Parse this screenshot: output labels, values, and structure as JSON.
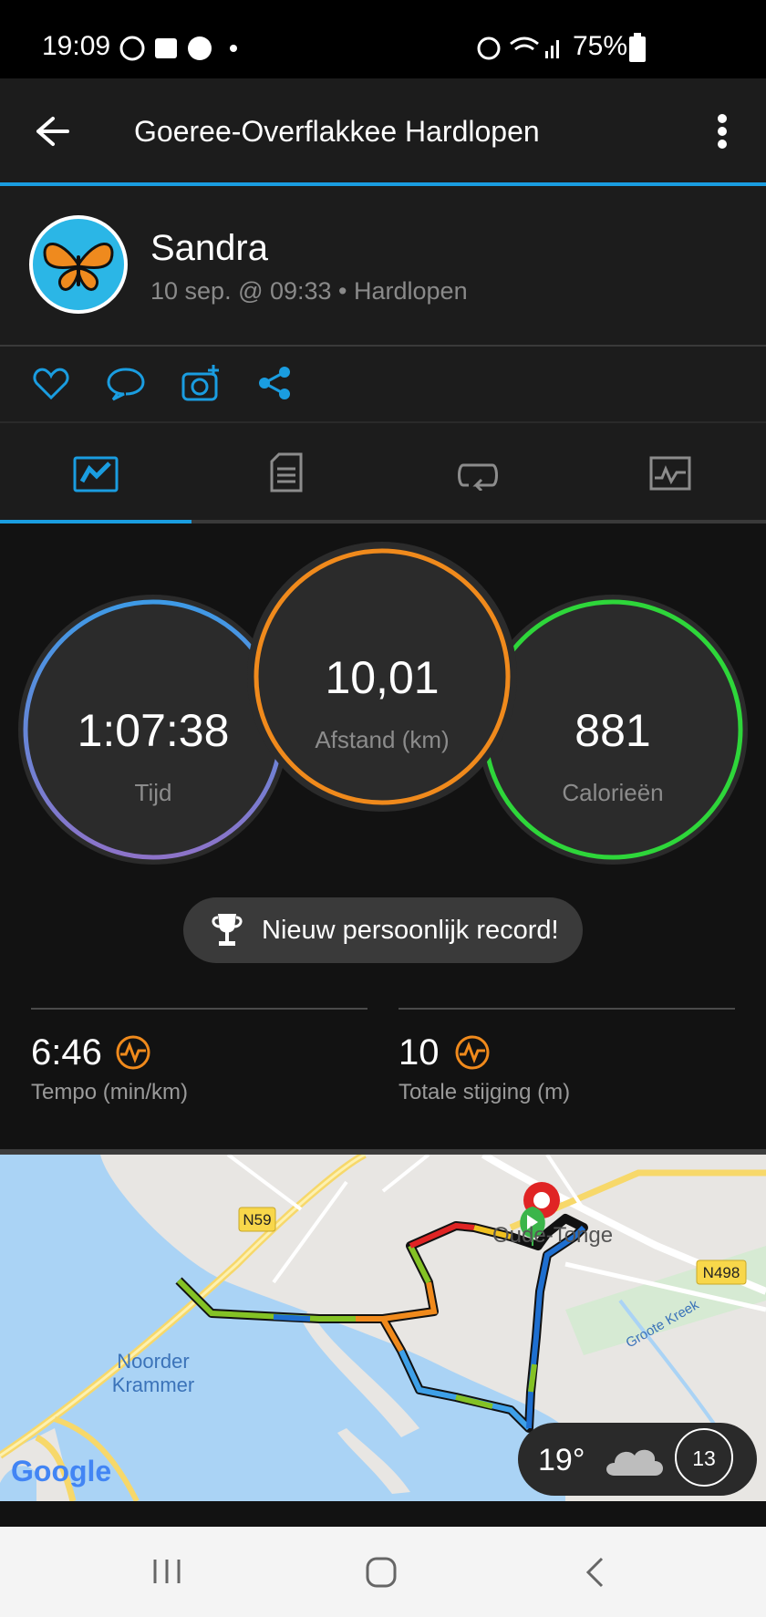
{
  "status_bar": {
    "time": "19:09",
    "battery": "75%"
  },
  "app_bar": {
    "title": "Goeree-Overflakkee Hardlopen"
  },
  "profile": {
    "name": "Sandra",
    "meta": "10 sep. @ 09:33 • Hardlopen"
  },
  "stats": {
    "time": {
      "value": "1:07:38",
      "label": "Tijd"
    },
    "distance": {
      "value": "10,01",
      "label": "Afstand (km)"
    },
    "calories": {
      "value": "881",
      "label": "Calorieën"
    }
  },
  "record": {
    "text": "Nieuw persoonlijk record!"
  },
  "metrics": {
    "pace": {
      "value": "6:46",
      "label": "Tempo (min/km)"
    },
    "ascent": {
      "value": "10",
      "label": "Totale stijging (m)"
    }
  },
  "map": {
    "labels": {
      "n59": "N59",
      "n498": "N498",
      "town": "Oude-Tonge",
      "water": "Noorder Krammer",
      "water_line1": "Noorder",
      "water_line2": "Krammer",
      "creek": "Groote Kreek",
      "google": "Google"
    }
  },
  "weather": {
    "temp": "19°",
    "wind": "13"
  },
  "colors": {
    "accent": "#1a9de0",
    "time_ring": "#5a8ee0",
    "distance_ring": "#f08a1c",
    "calories_ring": "#2ed63a",
    "metric_icon": "#f08a1c"
  }
}
